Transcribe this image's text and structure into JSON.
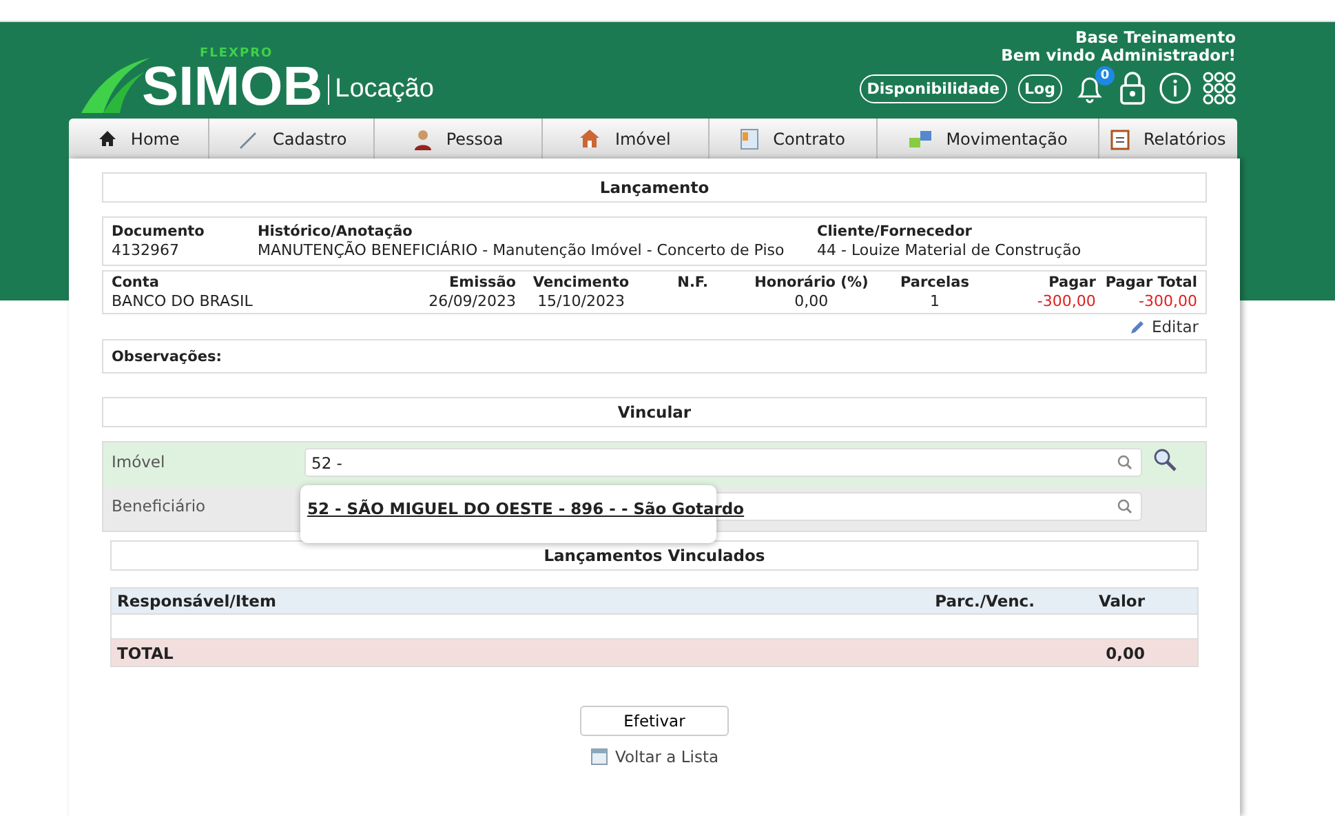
{
  "brand": {
    "tag": "FLEXPRO",
    "name": "SIMOB",
    "module": "Locação"
  },
  "header": {
    "company": "Base Treinamento",
    "welcome": "Bem vindo Administrador!",
    "buttons": [
      "Disponibilidade",
      "Log"
    ],
    "notifications": "0"
  },
  "menu": [
    {
      "label": "Home"
    },
    {
      "label": "Cadastro"
    },
    {
      "label": "Pessoa"
    },
    {
      "label": "Imóvel"
    },
    {
      "label": "Contrato"
    },
    {
      "label": "Movimentação"
    },
    {
      "label": "Relatórios"
    }
  ],
  "lancamento": {
    "title": "Lançamento",
    "row1": [
      {
        "label": "Documento",
        "value": "4132967"
      },
      {
        "label": "Histórico/Anotação",
        "value": "MANUTENÇÃO BENEFICIÁRIO - Manutenção Imóvel - Concerto de Piso"
      },
      {
        "label": "Cliente/Fornecedor",
        "value": "44 - Louize Material de Construção"
      }
    ],
    "row2": [
      {
        "label": "Conta",
        "value": "BANCO DO BRASIL",
        "negative": false
      },
      {
        "label": "Emissão",
        "value": "26/09/2023",
        "negative": false
      },
      {
        "label": "Vencimento",
        "value": "15/10/2023",
        "negative": false
      },
      {
        "label": "N.F.",
        "negative": false
      },
      {
        "label": "Honorário (%)",
        "value": "0,00",
        "negative": false
      },
      {
        "label": "Parcelas",
        "value": "1",
        "negative": false
      },
      {
        "label": "Pagar",
        "value": "-300,00",
        "negative": true
      },
      {
        "label": "Pagar Total",
        "value": "-300,00",
        "negative": true
      }
    ],
    "edit": "Editar",
    "observacoes": "Observações:"
  },
  "vincular": {
    "title": "Vincular",
    "fields": [
      {
        "label": "Imóvel",
        "value": "52 -",
        "highlighted": true
      },
      {
        "label": "Beneficiário",
        "highlighted": false
      }
    ],
    "suggestion": "52 - SÃO MIGUEL DO OESTE - 896 - - São Gotardo"
  },
  "vinculados": {
    "title": "Lançamentos Vinculados",
    "columns": [
      "Responsável/Item",
      "Parc./Venc.",
      "Valor"
    ],
    "total_label": "TOTAL",
    "total_value": "0,00"
  },
  "actions": {
    "submit": "Efetivar",
    "back": "Voltar a Lista"
  }
}
